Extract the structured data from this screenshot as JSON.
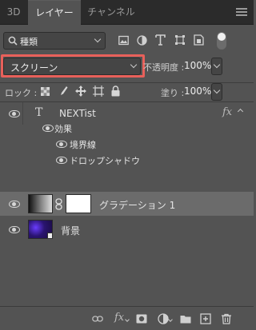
{
  "tabs": [
    {
      "label": "3D"
    },
    {
      "label": "レイヤー"
    },
    {
      "label": "チャンネル"
    }
  ],
  "filter": {
    "kind_label": "種類"
  },
  "blend": {
    "mode": "スクリーン"
  },
  "opacity": {
    "label": "不透明度 :",
    "value": "100%"
  },
  "lock": {
    "label": "ロック :"
  },
  "fill": {
    "label": "塗り :",
    "value": "100%"
  },
  "layers": [
    {
      "name": "NEXTist",
      "type": "text",
      "visible": true,
      "has_fx": true
    },
    {
      "name": "効果",
      "type": "effects-header",
      "visible": true
    },
    {
      "name": "境界線",
      "type": "effect",
      "visible": true
    },
    {
      "name": "ドロップシャドウ",
      "type": "effect",
      "visible": true
    },
    {
      "name": "グラデーション 1",
      "type": "gradient-fill",
      "visible": true,
      "selected": true
    },
    {
      "name": "背景",
      "type": "image",
      "visible": true
    }
  ],
  "colors": {
    "accent_highlight": "#e8605a",
    "panel": "#535353",
    "selected_row": "#6b6b6b"
  }
}
